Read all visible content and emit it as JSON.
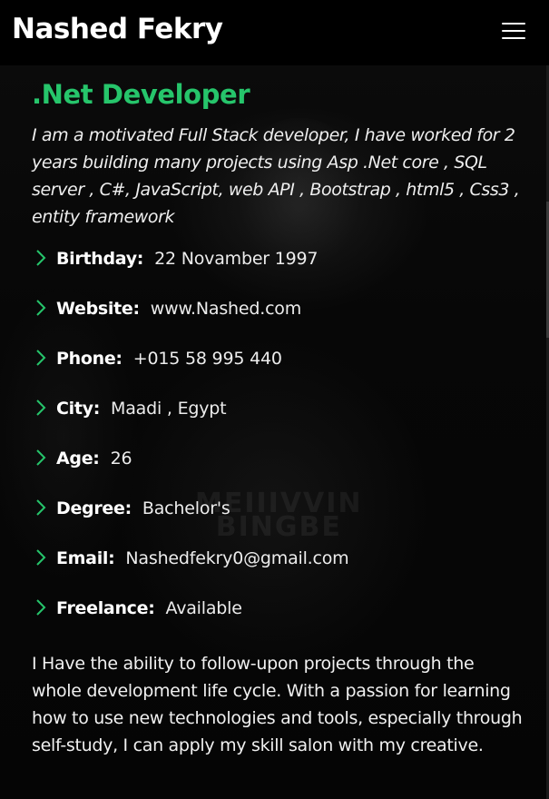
{
  "header": {
    "brand": "Nashed Fekry",
    "menu_icon": "hamburger-menu-icon"
  },
  "about": {
    "role": ".Net Developer",
    "intro": "I am a motivated Full Stack developer, I have worked for 2 years building many projects using Asp .Net core , SQL server , C#, JavaScript, web API , Bootstrap , html5 , Css3 , entity framework",
    "details": [
      {
        "label": "Birthday:",
        "value": "22 Novamber 1997"
      },
      {
        "label": "Website:",
        "value": "www.Nashed.com"
      },
      {
        "label": "Phone:",
        "value": "+015 58 995 440"
      },
      {
        "label": "City:",
        "value": "Maadi , Egypt"
      },
      {
        "label": "Age:",
        "value": "26"
      },
      {
        "label": "Degree:",
        "value": "Bachelor's"
      },
      {
        "label": "Email:",
        "value": "Nashedfekry0@gmail.com"
      },
      {
        "label": "Freelance:",
        "value": "Available"
      }
    ],
    "bullet_icon": "chevron-right-icon",
    "bio": "I Have the ability to follow-upon projects through the whole development life cycle. With a passion for learning how to use new technologies and tools, especially through self-study, I can apply my skill salon with my creative."
  },
  "colors": {
    "accent": "#26c56b",
    "background": "#000000",
    "text": "#ffffff"
  }
}
